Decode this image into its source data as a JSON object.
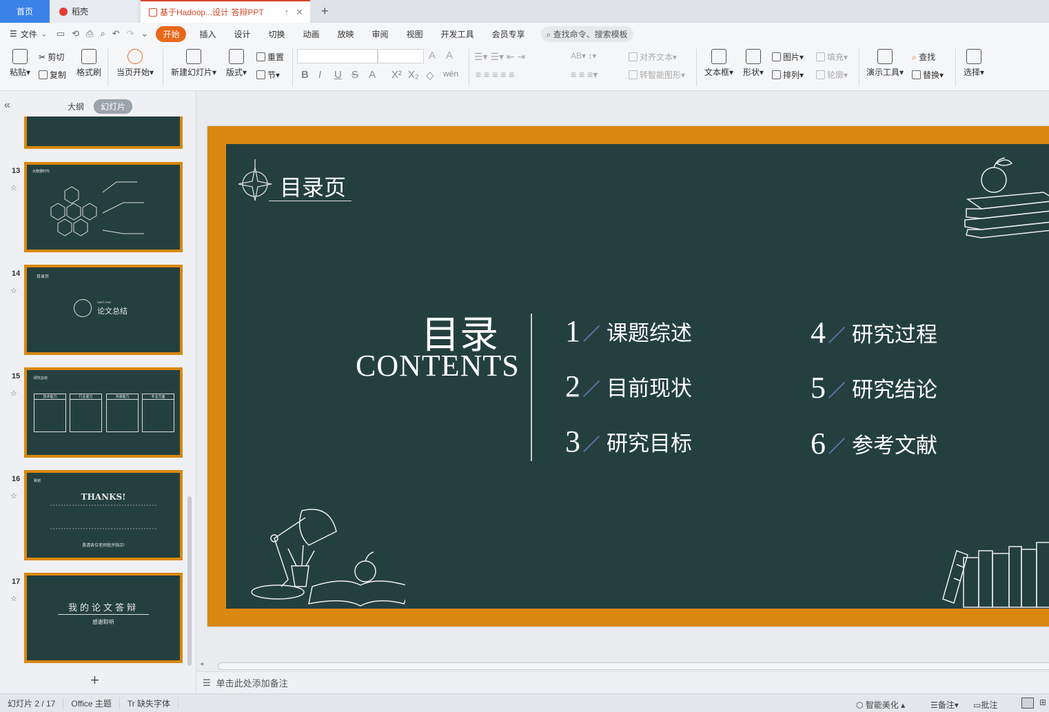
{
  "tabs": {
    "home": "首页",
    "docer": "稻壳",
    "document": "基于Hadoop...设计 答辩PPT",
    "add": "+"
  },
  "menu": {
    "file": "文件",
    "items": [
      "开始",
      "插入",
      "设计",
      "切换",
      "动画",
      "放映",
      "审阅",
      "视图",
      "开发工具",
      "会员专享"
    ],
    "search": "查找命令、搜索模板"
  },
  "ribbon": {
    "paste": "粘贴",
    "cut": "剪切",
    "copy": "复制",
    "format_painter": "格式刷",
    "from_current": "当页开始",
    "new_slide": "新建幻灯片",
    "layout": "版式",
    "reset": "重置",
    "section": "节",
    "align_text": "对齐文本",
    "smart_shape": "转智能图形",
    "textbox": "文本框",
    "shape": "形状",
    "picture": "图片",
    "arrange": "排列",
    "fill": "填充",
    "outline": "轮廓",
    "present_tools": "演示工具",
    "find": "查找",
    "replace": "替换",
    "select": "选择"
  },
  "left_panel": {
    "outline_tab": "大纲",
    "slides_tab": "幻灯片",
    "thumbnails": [
      {
        "num": "13",
        "title": "大数据时代"
      },
      {
        "num": "14",
        "title": "目录页",
        "part": "PART FIVE",
        "text": "论文总结"
      },
      {
        "num": "15",
        "title": "研究总结",
        "cols": [
          "技术能力",
          "行业能力",
          "沟通能力",
          "专业方面"
        ]
      },
      {
        "num": "16",
        "title": "致谢",
        "heading": "THANKS!",
        "footer": "恳请各位老师批评指正!"
      },
      {
        "num": "17",
        "heading": "我的论文答辩",
        "sub": "感谢聆听"
      }
    ]
  },
  "slide": {
    "page_title": "目录页",
    "title_cn": "目录",
    "title_en": "CONTENTS",
    "items": [
      {
        "num": "1",
        "text": "课题综述"
      },
      {
        "num": "2",
        "text": "目前现状"
      },
      {
        "num": "3",
        "text": "研究目标"
      },
      {
        "num": "4",
        "text": "研究过程"
      },
      {
        "num": "5",
        "text": "研究结论"
      },
      {
        "num": "6",
        "text": "参考文献"
      }
    ]
  },
  "notes_placeholder": "单击此处添加备注",
  "status": {
    "slide_counter": "幻灯片 2 / 17",
    "theme": "Office 主题",
    "missing_font": "缺失字体",
    "beautify": "智能美化",
    "notes": "备注",
    "comments": "批注"
  }
}
